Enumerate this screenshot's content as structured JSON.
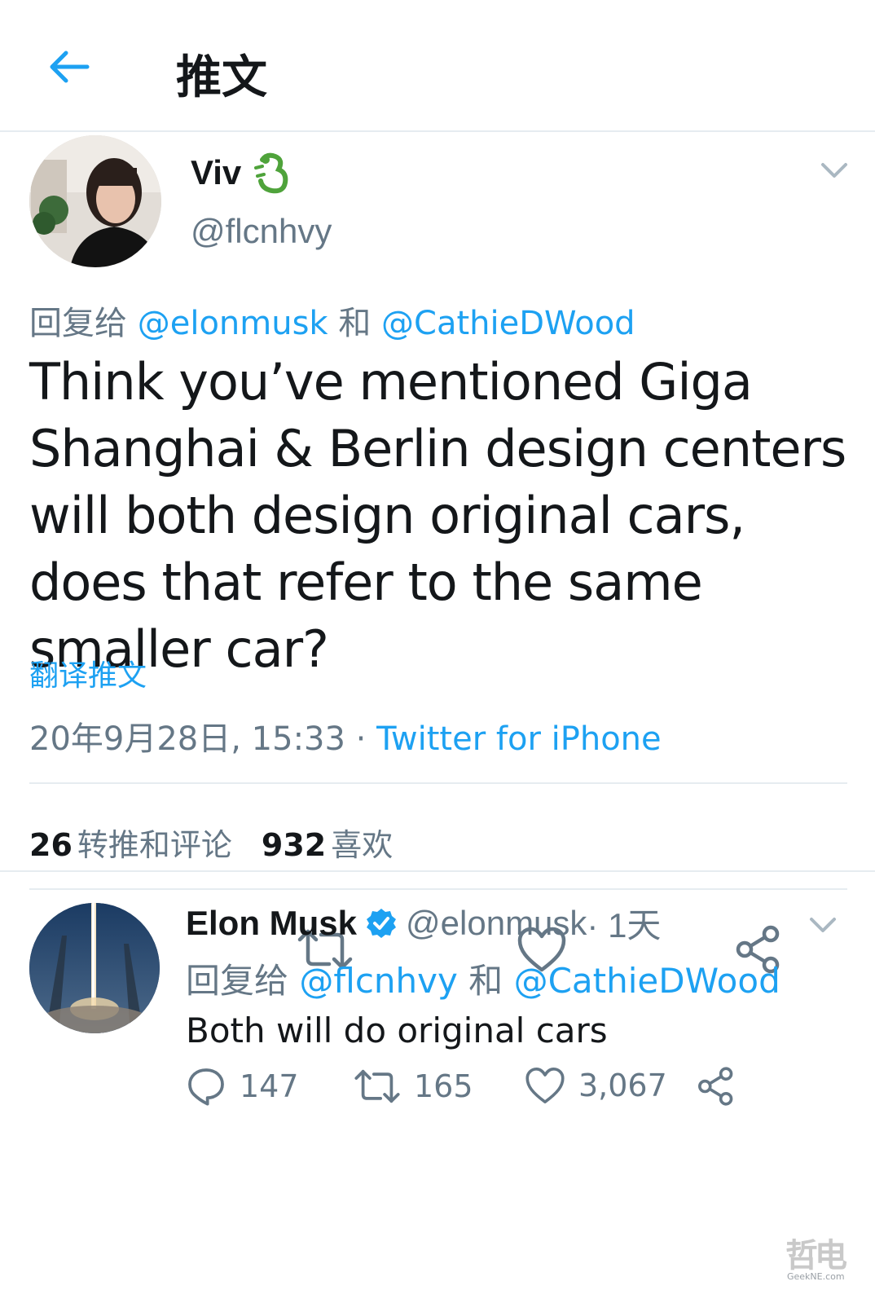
{
  "header": {
    "title": "推文"
  },
  "main_tweet": {
    "name": "Viv",
    "handle": "@flcnhvy",
    "reply_prefix": "回复给",
    "reply_to_1": "@elonmusk",
    "reply_joiner": "和",
    "reply_to_2": "@CathieDWood",
    "text": "Think you’ve mentioned Giga Shanghai & Berlin design centers will both design original cars, does that refer to the same smaller car?",
    "translate_label": "翻译推文",
    "timestamp": "20年9月28日, 15:33",
    "meta_sep": " · ",
    "source": "Twitter for iPhone",
    "retweet_count": "26",
    "retweet_label": "转推和评论",
    "like_count": "932",
    "like_label": "喜欢"
  },
  "reply_tweet": {
    "name": "Elon Musk",
    "handle": "@elonmusk",
    "time": " · 1天",
    "reply_prefix": "回复给",
    "reply_to_1": "@flcnhvy",
    "reply_joiner": "和",
    "reply_to_2": "@CathieDWood",
    "text": "Both will do original cars",
    "reply_count": "147",
    "retweet_count": "165",
    "like_count": "3,067"
  },
  "watermark": {
    "text": "哲电",
    "sub": "GeekNE.com"
  },
  "colors": {
    "accent": "#1da1f2",
    "text": "#14171a",
    "muted": "#657786",
    "divider": "#e6ecf0"
  },
  "icons": [
    "back-arrow-icon",
    "dragon-emoji-icon",
    "chevron-down-icon",
    "reply-icon",
    "retweet-icon",
    "like-icon",
    "share-icon",
    "verified-badge-icon"
  ]
}
